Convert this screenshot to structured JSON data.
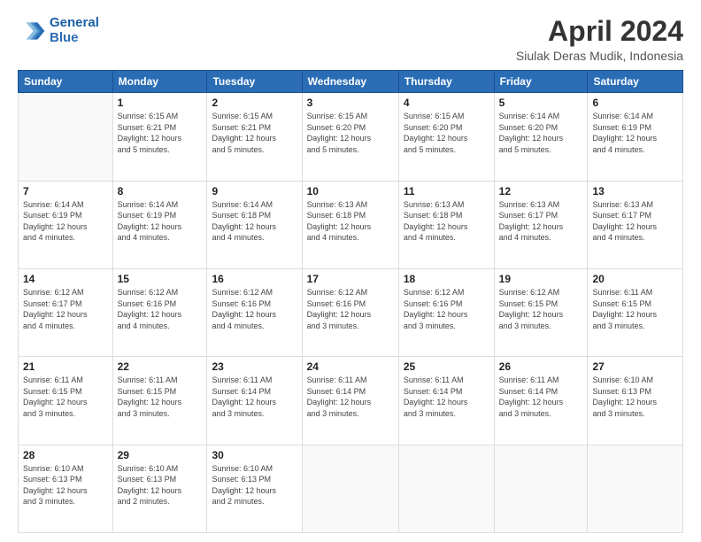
{
  "header": {
    "logo_line1": "General",
    "logo_line2": "Blue",
    "title": "April 2024",
    "subtitle": "Siulak Deras Mudik, Indonesia"
  },
  "calendar": {
    "days_of_week": [
      "Sunday",
      "Monday",
      "Tuesday",
      "Wednesday",
      "Thursday",
      "Friday",
      "Saturday"
    ],
    "weeks": [
      [
        {
          "day": "",
          "info": ""
        },
        {
          "day": "1",
          "info": "Sunrise: 6:15 AM\nSunset: 6:21 PM\nDaylight: 12 hours\nand 5 minutes."
        },
        {
          "day": "2",
          "info": "Sunrise: 6:15 AM\nSunset: 6:21 PM\nDaylight: 12 hours\nand 5 minutes."
        },
        {
          "day": "3",
          "info": "Sunrise: 6:15 AM\nSunset: 6:20 PM\nDaylight: 12 hours\nand 5 minutes."
        },
        {
          "day": "4",
          "info": "Sunrise: 6:15 AM\nSunset: 6:20 PM\nDaylight: 12 hours\nand 5 minutes."
        },
        {
          "day": "5",
          "info": "Sunrise: 6:14 AM\nSunset: 6:20 PM\nDaylight: 12 hours\nand 5 minutes."
        },
        {
          "day": "6",
          "info": "Sunrise: 6:14 AM\nSunset: 6:19 PM\nDaylight: 12 hours\nand 4 minutes."
        }
      ],
      [
        {
          "day": "7",
          "info": "Sunrise: 6:14 AM\nSunset: 6:19 PM\nDaylight: 12 hours\nand 4 minutes."
        },
        {
          "day": "8",
          "info": "Sunrise: 6:14 AM\nSunset: 6:19 PM\nDaylight: 12 hours\nand 4 minutes."
        },
        {
          "day": "9",
          "info": "Sunrise: 6:14 AM\nSunset: 6:18 PM\nDaylight: 12 hours\nand 4 minutes."
        },
        {
          "day": "10",
          "info": "Sunrise: 6:13 AM\nSunset: 6:18 PM\nDaylight: 12 hours\nand 4 minutes."
        },
        {
          "day": "11",
          "info": "Sunrise: 6:13 AM\nSunset: 6:18 PM\nDaylight: 12 hours\nand 4 minutes."
        },
        {
          "day": "12",
          "info": "Sunrise: 6:13 AM\nSunset: 6:17 PM\nDaylight: 12 hours\nand 4 minutes."
        },
        {
          "day": "13",
          "info": "Sunrise: 6:13 AM\nSunset: 6:17 PM\nDaylight: 12 hours\nand 4 minutes."
        }
      ],
      [
        {
          "day": "14",
          "info": "Sunrise: 6:12 AM\nSunset: 6:17 PM\nDaylight: 12 hours\nand 4 minutes."
        },
        {
          "day": "15",
          "info": "Sunrise: 6:12 AM\nSunset: 6:16 PM\nDaylight: 12 hours\nand 4 minutes."
        },
        {
          "day": "16",
          "info": "Sunrise: 6:12 AM\nSunset: 6:16 PM\nDaylight: 12 hours\nand 4 minutes."
        },
        {
          "day": "17",
          "info": "Sunrise: 6:12 AM\nSunset: 6:16 PM\nDaylight: 12 hours\nand 3 minutes."
        },
        {
          "day": "18",
          "info": "Sunrise: 6:12 AM\nSunset: 6:16 PM\nDaylight: 12 hours\nand 3 minutes."
        },
        {
          "day": "19",
          "info": "Sunrise: 6:12 AM\nSunset: 6:15 PM\nDaylight: 12 hours\nand 3 minutes."
        },
        {
          "day": "20",
          "info": "Sunrise: 6:11 AM\nSunset: 6:15 PM\nDaylight: 12 hours\nand 3 minutes."
        }
      ],
      [
        {
          "day": "21",
          "info": "Sunrise: 6:11 AM\nSunset: 6:15 PM\nDaylight: 12 hours\nand 3 minutes."
        },
        {
          "day": "22",
          "info": "Sunrise: 6:11 AM\nSunset: 6:15 PM\nDaylight: 12 hours\nand 3 minutes."
        },
        {
          "day": "23",
          "info": "Sunrise: 6:11 AM\nSunset: 6:14 PM\nDaylight: 12 hours\nand 3 minutes."
        },
        {
          "day": "24",
          "info": "Sunrise: 6:11 AM\nSunset: 6:14 PM\nDaylight: 12 hours\nand 3 minutes."
        },
        {
          "day": "25",
          "info": "Sunrise: 6:11 AM\nSunset: 6:14 PM\nDaylight: 12 hours\nand 3 minutes."
        },
        {
          "day": "26",
          "info": "Sunrise: 6:11 AM\nSunset: 6:14 PM\nDaylight: 12 hours\nand 3 minutes."
        },
        {
          "day": "27",
          "info": "Sunrise: 6:10 AM\nSunset: 6:13 PM\nDaylight: 12 hours\nand 3 minutes."
        }
      ],
      [
        {
          "day": "28",
          "info": "Sunrise: 6:10 AM\nSunset: 6:13 PM\nDaylight: 12 hours\nand 3 minutes."
        },
        {
          "day": "29",
          "info": "Sunrise: 6:10 AM\nSunset: 6:13 PM\nDaylight: 12 hours\nand 2 minutes."
        },
        {
          "day": "30",
          "info": "Sunrise: 6:10 AM\nSunset: 6:13 PM\nDaylight: 12 hours\nand 2 minutes."
        },
        {
          "day": "",
          "info": ""
        },
        {
          "day": "",
          "info": ""
        },
        {
          "day": "",
          "info": ""
        },
        {
          "day": "",
          "info": ""
        }
      ]
    ]
  }
}
